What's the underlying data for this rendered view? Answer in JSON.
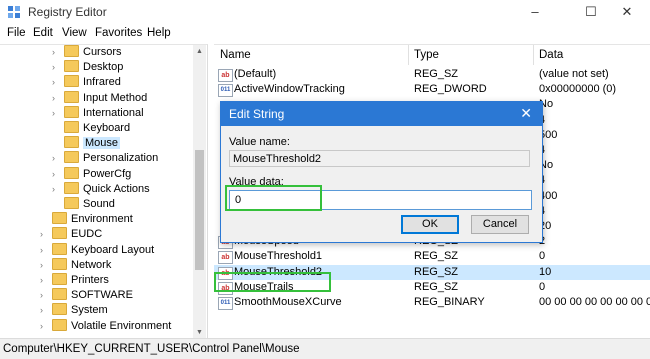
{
  "window": {
    "title": "Registry Editor",
    "minimize": "–",
    "maximize": "☐",
    "close": "✕"
  },
  "menu": [
    "File",
    "Edit",
    "View",
    "Favorites",
    "Help"
  ],
  "tree": [
    {
      "label": "Cursors",
      "indent": 2,
      "chevron": "›"
    },
    {
      "label": "Desktop",
      "indent": 2,
      "chevron": "›"
    },
    {
      "label": "Infrared",
      "indent": 2,
      "chevron": "›"
    },
    {
      "label": "Input Method",
      "indent": 2,
      "chevron": "›"
    },
    {
      "label": "International",
      "indent": 2,
      "chevron": "›"
    },
    {
      "label": "Keyboard",
      "indent": 2,
      "chevron": ""
    },
    {
      "label": "Mouse",
      "indent": 2,
      "chevron": "",
      "selected": true
    },
    {
      "label": "Personalization",
      "indent": 2,
      "chevron": "›"
    },
    {
      "label": "PowerCfg",
      "indent": 2,
      "chevron": "›"
    },
    {
      "label": "Quick Actions",
      "indent": 2,
      "chevron": "›"
    },
    {
      "label": "Sound",
      "indent": 2,
      "chevron": ""
    },
    {
      "label": "Environment",
      "indent": 1,
      "chevron": ""
    },
    {
      "label": "EUDC",
      "indent": 1,
      "chevron": "›"
    },
    {
      "label": "Keyboard Layout",
      "indent": 1,
      "chevron": "›"
    },
    {
      "label": "Network",
      "indent": 1,
      "chevron": "›"
    },
    {
      "label": "Printers",
      "indent": 1,
      "chevron": "›"
    },
    {
      "label": "SOFTWARE",
      "indent": 1,
      "chevron": "›"
    },
    {
      "label": "System",
      "indent": 1,
      "chevron": "›"
    },
    {
      "label": "Volatile Environment",
      "indent": 1,
      "chevron": "›"
    }
  ],
  "columns": {
    "name": "Name",
    "type": "Type",
    "data": "Data"
  },
  "values": [
    {
      "name": "(Default)",
      "type": "REG_SZ",
      "data": "(value not set)",
      "icon": "ab",
      "row": 0
    },
    {
      "name": "ActiveWindowTracking",
      "type": "REG_DWORD",
      "data": "0x00000000 (0)",
      "icon": "bin",
      "row": 1
    },
    {
      "name": "",
      "type": "",
      "data": "No",
      "icon": "",
      "row": 2
    },
    {
      "name": "",
      "type": "",
      "data": "4",
      "icon": "",
      "row": 3
    },
    {
      "name": "",
      "type": "",
      "data": "500",
      "icon": "",
      "row": 4
    },
    {
      "name": "",
      "type": "",
      "data": "4",
      "icon": "",
      "row": 5
    },
    {
      "name": "",
      "type": "",
      "data": "No",
      "icon": "",
      "row": 6
    },
    {
      "name": "",
      "type": "",
      "data": "4",
      "icon": "",
      "row": 7
    },
    {
      "name": "",
      "type": "",
      "data": "400",
      "icon": "",
      "row": 8
    },
    {
      "name": "",
      "type": "",
      "data": "4",
      "icon": "",
      "row": 9
    },
    {
      "name": "",
      "type": "",
      "data": "20",
      "icon": "",
      "row": 10
    },
    {
      "name": "MouseSpeed",
      "type": "REG_SZ",
      "data": "2",
      "icon": "ab",
      "row": 11
    },
    {
      "name": "MouseThreshold1",
      "type": "REG_SZ",
      "data": "0",
      "icon": "ab",
      "row": 12
    },
    {
      "name": "MouseThreshold2",
      "type": "REG_SZ",
      "data": "10",
      "icon": "ab",
      "row": 13,
      "selected": true
    },
    {
      "name": "MouseTrails",
      "type": "REG_SZ",
      "data": "0",
      "icon": "ab",
      "row": 14
    },
    {
      "name": "SmoothMouseXCurve",
      "type": "REG_BINARY",
      "data": "00 00 00 00 00 00 00 0",
      "icon": "bin",
      "row": 15
    }
  ],
  "status": "Computer\\HKEY_CURRENT_USER\\Control Panel\\Mouse",
  "dialog": {
    "title": "Edit String",
    "close": "✕",
    "value_name_label": "Value name:",
    "value_name": "MouseThreshold2",
    "value_data_label": "Value data:",
    "value_data": "0",
    "ok": "OK",
    "cancel": "Cancel"
  },
  "colors": {
    "accent": "#2b78d4",
    "highlight": "#35c03b",
    "selection": "#cce8ff"
  }
}
